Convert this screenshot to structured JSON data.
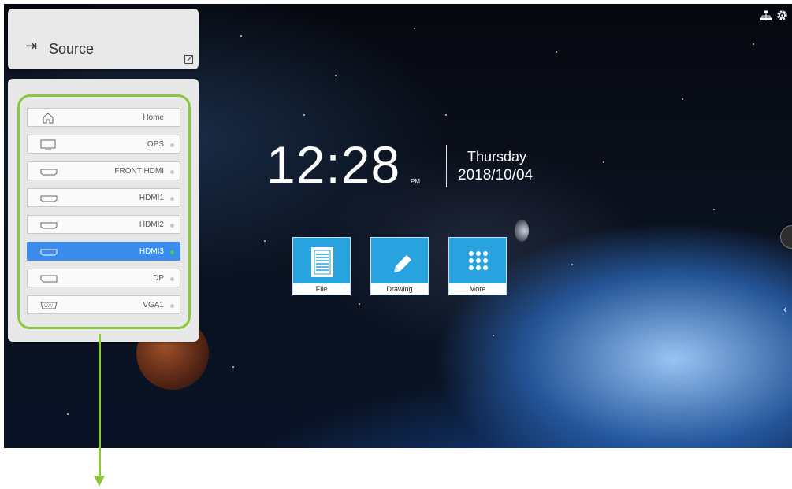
{
  "source_panel": {
    "title": "Source",
    "items": [
      {
        "label": "Home",
        "icon": "home-icon",
        "active": false,
        "has_dot": false
      },
      {
        "label": "OPS",
        "icon": "monitor-icon",
        "active": false,
        "has_dot": true
      },
      {
        "label": "FRONT HDMI",
        "icon": "hdmi-port-icon",
        "active": false,
        "has_dot": true
      },
      {
        "label": "HDMI1",
        "icon": "hdmi-port-icon",
        "active": false,
        "has_dot": true
      },
      {
        "label": "HDMI2",
        "icon": "hdmi-port-icon",
        "active": false,
        "has_dot": true
      },
      {
        "label": "HDMI3",
        "icon": "hdmi-port-icon",
        "active": true,
        "has_dot": true
      },
      {
        "label": "DP",
        "icon": "displayport-icon",
        "active": false,
        "has_dot": true
      },
      {
        "label": "VGA1",
        "icon": "vga-port-icon",
        "active": false,
        "has_dot": true
      }
    ]
  },
  "clock": {
    "time": "12:28",
    "ampm": "PM",
    "day": "Thursday",
    "date": "2018/10/04"
  },
  "apps": [
    {
      "label": "File",
      "icon": "file-icon"
    },
    {
      "label": "Drawing",
      "icon": "pencil-icon"
    },
    {
      "label": "More",
      "icon": "grid-dots-icon"
    }
  ],
  "colors": {
    "highlight": "#8cc63f",
    "active_item": "#3b8ced",
    "app_tile": "#29a3df",
    "active_dot": "#39d34a"
  }
}
